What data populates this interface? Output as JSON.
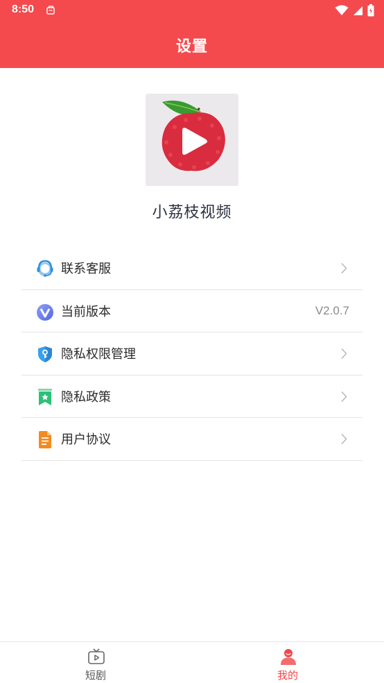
{
  "status_bar": {
    "time": "8:50"
  },
  "header": {
    "title": "设置"
  },
  "app": {
    "name": "小荔枝视频"
  },
  "menu": {
    "items": [
      {
        "label": "联系客服",
        "icon": "customer-service-icon"
      },
      {
        "label": "当前版本",
        "icon": "version-icon",
        "value": "V2.0.7"
      },
      {
        "label": "隐私权限管理",
        "icon": "privacy-shield-icon"
      },
      {
        "label": "隐私政策",
        "icon": "privacy-policy-bookmark-icon"
      },
      {
        "label": "用户协议",
        "icon": "user-agreement-document-icon"
      }
    ]
  },
  "bottom_nav": {
    "items": [
      {
        "label": "短剧",
        "icon": "tv-play-icon",
        "active": false
      },
      {
        "label": "我的",
        "icon": "user-profile-icon",
        "active": true
      }
    ]
  },
  "colors": {
    "brand_red": "#f44a4e",
    "active_tab": "#f4474b",
    "divider": "#e3e3e3"
  }
}
